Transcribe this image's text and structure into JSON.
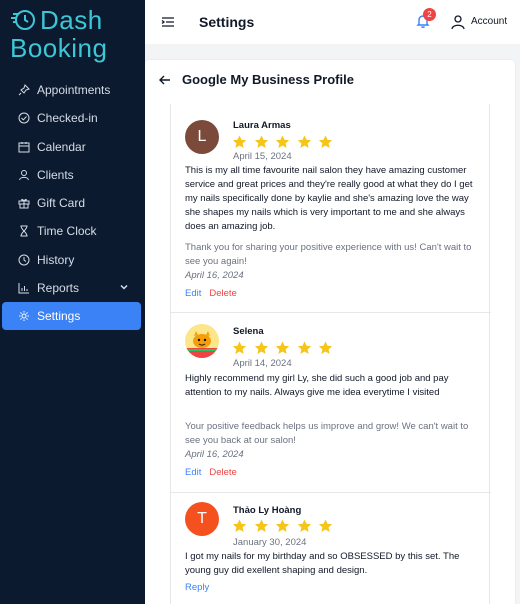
{
  "app": {
    "logo_line1": "Dash",
    "logo_line2": "Booking"
  },
  "sidebar": {
    "items": [
      {
        "label": "Appointments",
        "icon": "pin-icon"
      },
      {
        "label": "Checked-in",
        "icon": "check-circle-icon"
      },
      {
        "label": "Calendar",
        "icon": "calendar-icon"
      },
      {
        "label": "Clients",
        "icon": "user-icon"
      },
      {
        "label": "Gift Card",
        "icon": "gift-icon"
      },
      {
        "label": "Time Clock",
        "icon": "hourglass-icon"
      },
      {
        "label": "History",
        "icon": "history-icon"
      },
      {
        "label": "Reports",
        "icon": "chart-icon"
      },
      {
        "label": "Settings",
        "icon": "gear-icon"
      }
    ],
    "active": "Settings"
  },
  "topbar": {
    "title": "Settings",
    "notifications": "2",
    "account_label": "Account"
  },
  "page": {
    "section_title": "Google My Business Profile"
  },
  "reviews": [
    {
      "avatar_letter": "L",
      "avatar_color": "#7b4a3a",
      "name": "Laura Armas",
      "rating": 5,
      "date": "April 15, 2024",
      "text": "This is my all time favourite nail salon they have amazing customer service and great prices and they're really good at what they do I get my nails specifically done by kaylie and she's amazing love the way she shapes my nails which is very important to me and she always does an amazing job.",
      "reply": "Thank you for sharing your positive experience with us! Can't wait to see you again!",
      "reply_date": "April 16, 2024",
      "edit_label": "Edit",
      "delete_label": "Delete"
    },
    {
      "avatar_letter": "",
      "avatar_color": "#f59e0b",
      "name": "Selena",
      "rating": 5,
      "date": "April 14, 2024",
      "text": "Highly recommend my girl Ly, she did such a good job and pay attention to my nails. Always give me idea everytime I visited",
      "reply": "Your positive feedback helps us improve and grow! We can't wait to see you back at our salon!",
      "reply_date": "April 16, 2024",
      "edit_label": "Edit",
      "delete_label": "Delete"
    },
    {
      "avatar_letter": "T",
      "avatar_color": "#f4511e",
      "name": "Thảo Ly Hoàng",
      "rating": 5,
      "date": "January 30, 2024",
      "text": "I got my nails for my birthday and so OBSESSED by this set. The young guy did exellent shaping and design.",
      "reply_label": "Reply"
    }
  ],
  "colors": {
    "sidebar_bg": "#0b1a2e",
    "accent": "#3b82f6",
    "star": "#f5c518",
    "danger": "#ef4444",
    "logo": "#3cc6d6"
  }
}
